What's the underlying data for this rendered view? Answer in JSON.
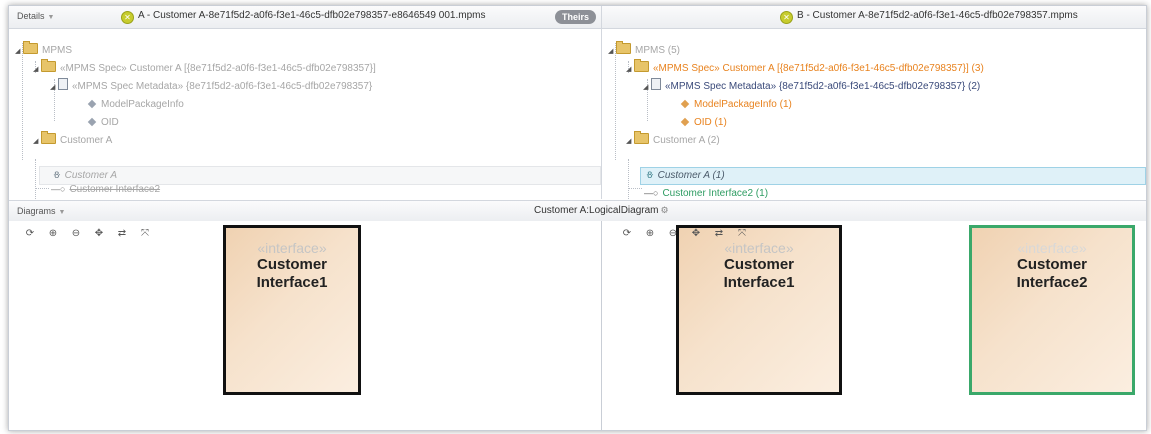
{
  "header": {
    "details_label": "Details",
    "left_title": "A - Customer A-8e71f5d2-a0f6-f3e1-46c5-dfb02e798357-e8646549 001.mpms",
    "right_title": "B - Customer A-8e71f5d2-a0f6-f3e1-46c5-dfb02e798357.mpms",
    "theirs_badge": "Theirs"
  },
  "tree_left": {
    "items": [
      {
        "label": "MPMS"
      },
      {
        "label": "«MPMS Spec» Customer A [{8e71f5d2-a0f6-f3e1-46c5-dfb02e798357}]"
      },
      {
        "label": "«MPMS Spec Metadata» {8e71f5d2-a0f6-f3e1-46c5-dfb02e798357}"
      },
      {
        "label": "ModelPackageInfo"
      },
      {
        "label": "OID"
      },
      {
        "label": "Customer A"
      },
      {
        "label": "Customer A"
      },
      {
        "label": "Customer Interface2"
      }
    ]
  },
  "tree_right": {
    "items": [
      {
        "label": "MPMS (5)"
      },
      {
        "label": "«MPMS Spec» Customer A [{8e71f5d2-a0f6-f3e1-46c5-dfb02e798357}] (3)"
      },
      {
        "label": "«MPMS Spec Metadata» {8e71f5d2-a0f6-f3e1-46c5-dfb02e798357} (2)"
      },
      {
        "label": "ModelPackageInfo (1)"
      },
      {
        "label": "OID (1)"
      },
      {
        "label": "Customer A (2)"
      },
      {
        "label": "Customer A (1)"
      },
      {
        "label": "Customer Interface2 (1)"
      }
    ]
  },
  "diagrams": {
    "label": "Diagrams",
    "title": "Customer A:LogicalDiagram"
  },
  "toolbar": {
    "icons": [
      "refresh-icon",
      "zoom-in-icon",
      "zoom-out-icon",
      "pan-icon",
      "swap-icon",
      "fit-icon"
    ]
  },
  "nodes": {
    "left_1": {
      "stereotype": "«interface»",
      "name": "Customer\nInterface1"
    },
    "right_1": {
      "stereotype": "«interface»",
      "name": "Customer\nInterface1"
    },
    "right_2": {
      "stereotype": "«interface»",
      "name": "Customer\nInterface2"
    }
  },
  "colors": {
    "added": "#3aa86a",
    "changed": "#e8821e",
    "selection": "#dff1f8"
  }
}
